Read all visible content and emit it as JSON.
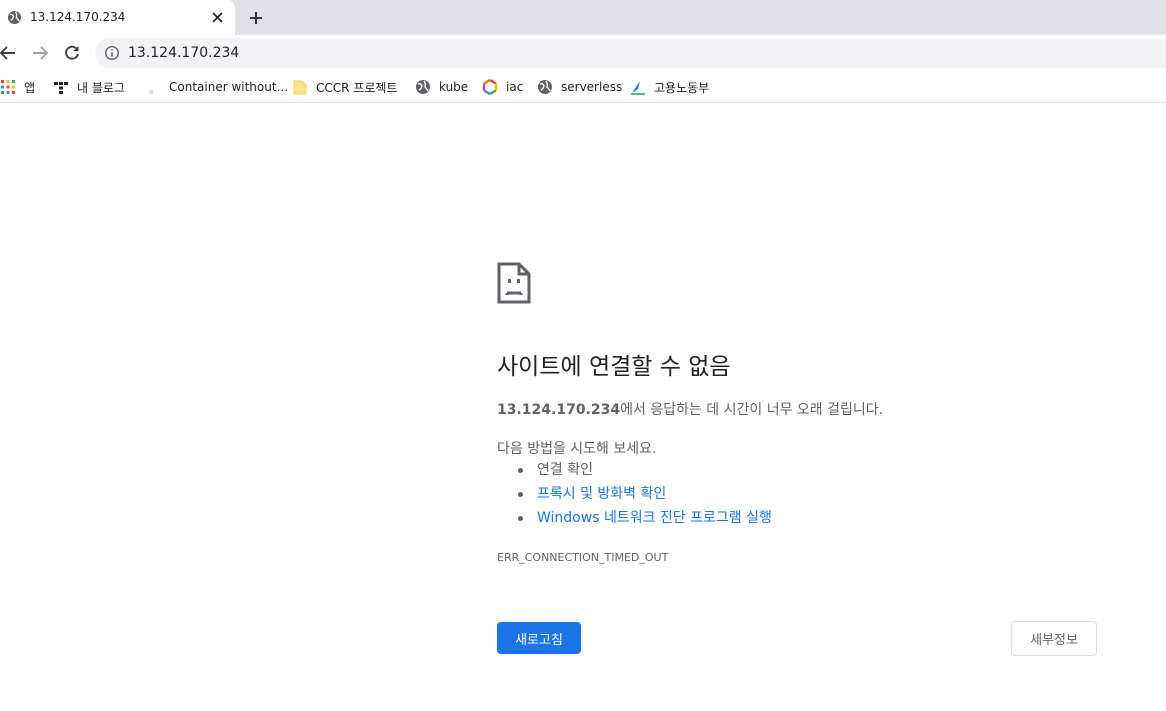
{
  "tab": {
    "title": "13.124.170.234"
  },
  "omnibox": {
    "url": "13.124.170.234"
  },
  "bookmarks": [
    {
      "label": "앱",
      "icon": "apps-grid-icon"
    },
    {
      "label": "내 블로그",
      "icon": "blog-icon"
    },
    {
      "label": "Container without...",
      "icon": "page-icon"
    },
    {
      "label": "CCCR 프로젝트",
      "icon": "folder-icon"
    },
    {
      "label": "kube",
      "icon": "globe-icon"
    },
    {
      "label": "iac",
      "icon": "hexagon-icon"
    },
    {
      "label": "serverless",
      "icon": "globe-icon"
    },
    {
      "label": "고용노동부",
      "icon": "ministry-logo-icon"
    }
  ],
  "error": {
    "title": "사이트에 연결할 수 없음",
    "host": "13.124.170.234",
    "message_rest": "에서 응답하는 데 시간이 너무 오래 걸립니다.",
    "try_heading": "다음 방법을 시도해 보세요.",
    "suggestions": [
      "연결 확인",
      "프록시 및 방화벽 확인",
      "Windows 네트워크 진단 프로그램 실행"
    ],
    "code": "ERR_CONNECTION_TIMED_OUT",
    "reload_label": "새로고침",
    "details_label": "세부정보"
  },
  "colors": {
    "primary_button": "#1a73e8",
    "link": "#1a73e8",
    "secondary_text": "#5f6368",
    "tabstrip": "#dee1e6",
    "omnibox": "#f1f3f4"
  }
}
